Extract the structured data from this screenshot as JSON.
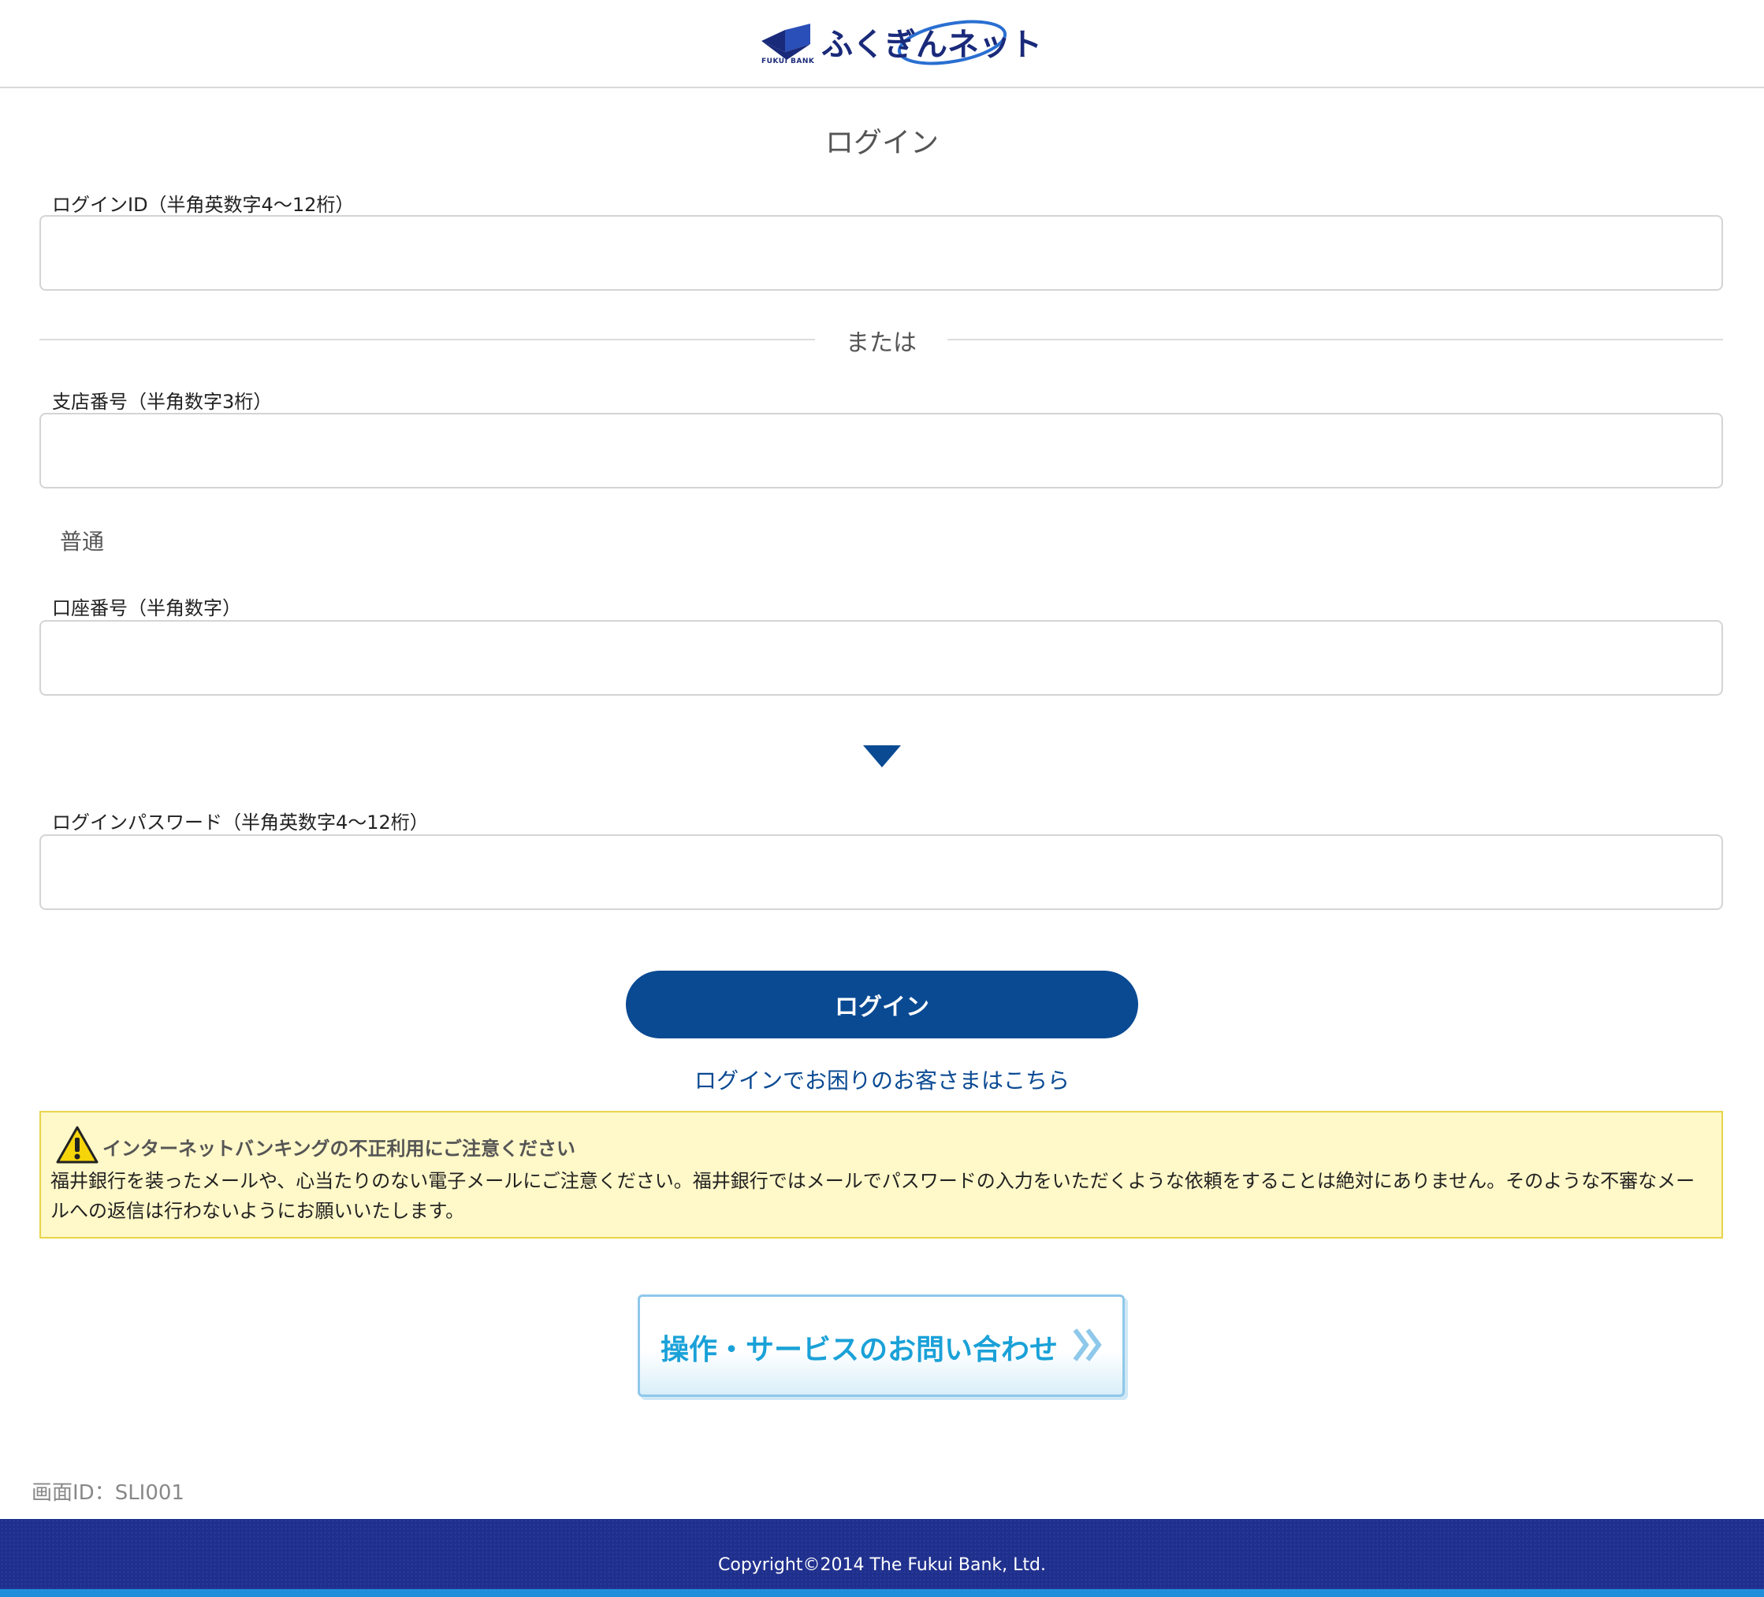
{
  "header": {
    "logo_text": "ふくぎん",
    "logo_net": "ネット",
    "logo_bank": "FUKUI BANK"
  },
  "page_title": "ログイン",
  "login_id": {
    "label": "ログインID（半角英数字4〜12桁）",
    "value": ""
  },
  "or_label": "または",
  "branch": {
    "label": "支店番号（半角数字3桁）",
    "value": ""
  },
  "account_type": "普通",
  "account_number": {
    "label": "口座番号（半角数字）",
    "value": ""
  },
  "password": {
    "label": "ログインパスワード（半角英数字4〜12桁）",
    "value": ""
  },
  "login_button": "ログイン",
  "help_link": "ログインでお困りのお客さまはこちら",
  "warning": {
    "title": "インターネットバンキングの不正利用にご注意ください",
    "body": "福井銀行を装ったメールや、心当たりのない電子メールにご注意ください。福井銀行ではメールでパスワードの入力をいただくような依頼をすることは絶対にありません。そのような不審なメールへの返信は行わないようにお願いいたします。"
  },
  "contact_button": "操作・サービスのお問い合わせ",
  "screen_id": "画面ID：SLI001",
  "footer": {
    "copyright": "Copyright©2014 The Fukui Bank, Ltd."
  },
  "colors": {
    "primary": "#0a4a93",
    "footer_bg": "#1f2f8c",
    "warning_bg": "#fff8c8",
    "contact_text": "#1aa1d8"
  }
}
